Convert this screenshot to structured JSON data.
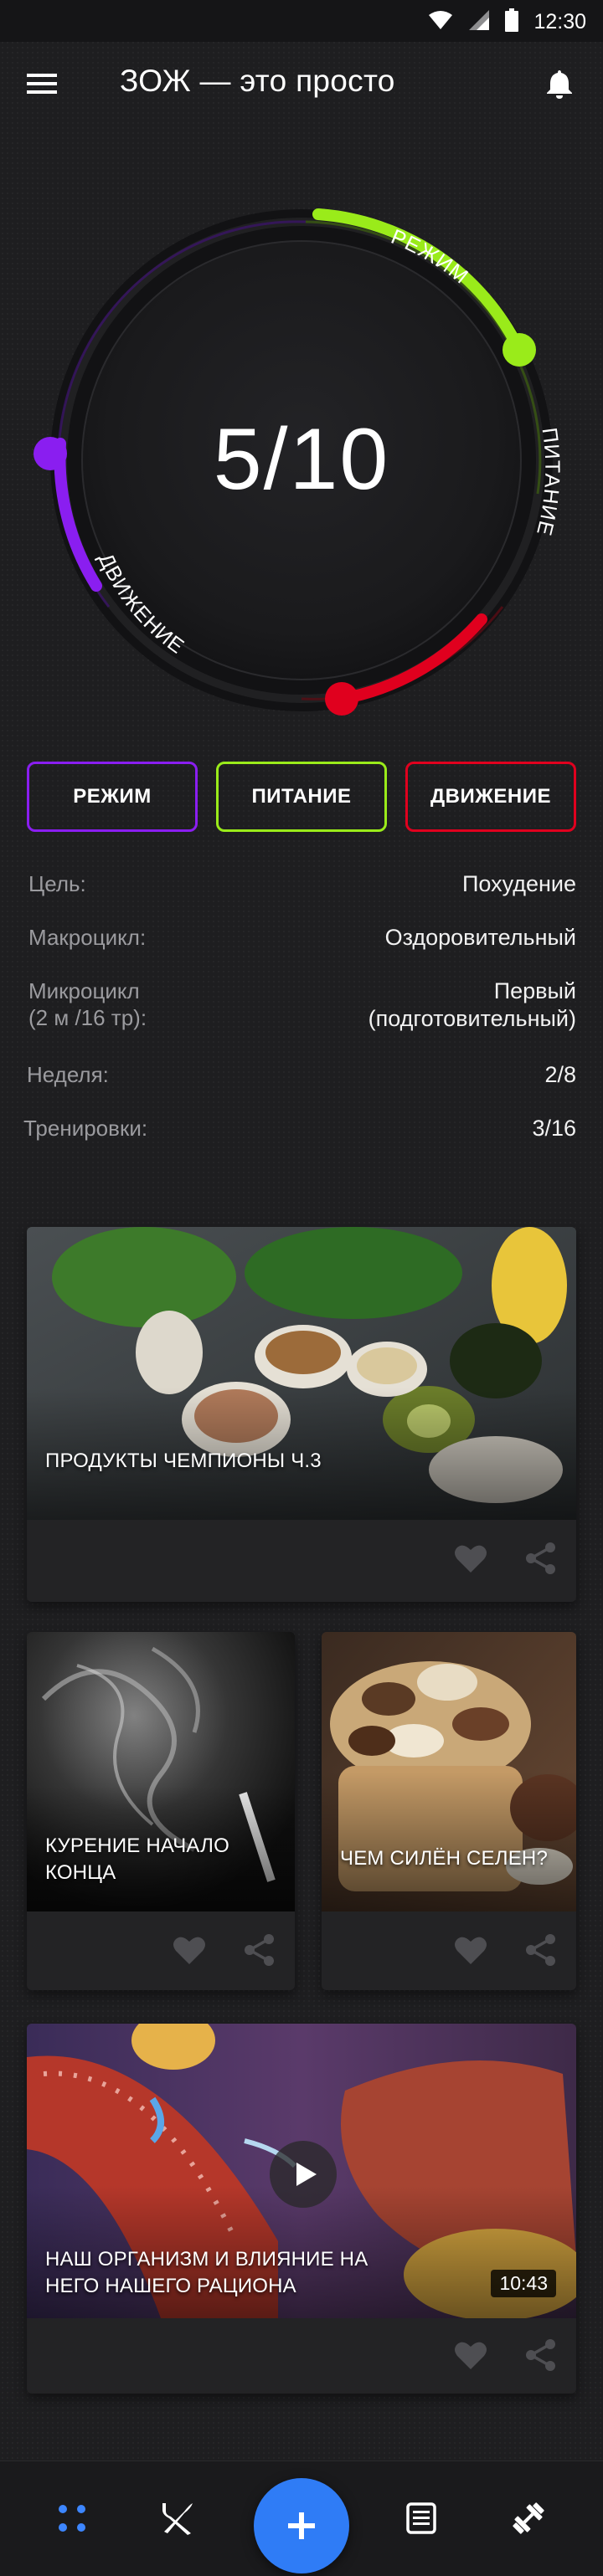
{
  "status_bar": {
    "time": "12:30",
    "icons": [
      "wifi-icon",
      "signal-icon",
      "battery-icon"
    ]
  },
  "app_bar": {
    "title": "ЗОЖ — это просто",
    "menu_icon": "hamburger-icon",
    "bell_icon": "bell-icon"
  },
  "gauge": {
    "score": "5/10",
    "labels": {
      "regime": "РЕЖИМ",
      "nutrition": "ПИТАНИЕ",
      "movement": "ДВИЖЕНИЕ"
    },
    "colors": {
      "regime": "#9aeb1a",
      "nutrition": "#e0001e",
      "movement": "#8a1ef0"
    }
  },
  "pillars": [
    {
      "label": "РЕЖИМ",
      "color": "#8a1ef0"
    },
    {
      "label": "ПИТАНИЕ",
      "color": "#9aeb1a"
    },
    {
      "label": "ДВИЖЕНИЕ",
      "color": "#e0001e"
    }
  ],
  "info": {
    "goal": {
      "label": "Цель:",
      "value": "Похудение"
    },
    "macrocycle": {
      "label": "Макроцикл:",
      "value": "Оздоровительный"
    },
    "microcycle": {
      "label_line1": "Микроцикл",
      "label_line2": "(2 м /16 тр):",
      "value_line1": "Первый",
      "value_line2": "(подготовительный)"
    },
    "week": {
      "label": "Неделя:",
      "value": "2/8"
    },
    "workouts": {
      "label": "Тренировки:",
      "value": "3/16"
    }
  },
  "cards": {
    "foods": {
      "title": "ПРОДУКТЫ ЧЕМПИОНЫ Ч.3"
    },
    "smoking": {
      "title_line1": "КУРЕНИЕ НАЧАЛО",
      "title_line2": "КОНЦА"
    },
    "selenium": {
      "title": "ЧЕМ СИЛЁН СЕЛЕН?"
    },
    "video": {
      "title_line1": "НАШ ОРГАНИЗМ И ВЛИЯНИЕ НА",
      "title_line2": "НЕГО НАШЕГО РАЦИОНА",
      "duration": "10:43"
    }
  },
  "bottom_nav": {
    "items": [
      "dashboard-icon",
      "cutlery-icon",
      "plus-icon",
      "list-icon",
      "dumbbell-icon"
    ],
    "fab_color": "#2f7cf6"
  }
}
